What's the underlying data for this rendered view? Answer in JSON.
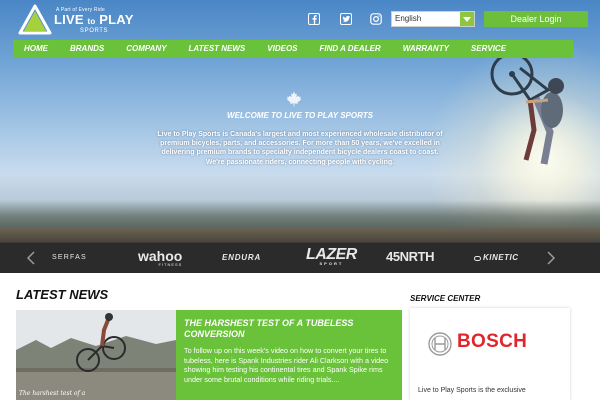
{
  "header": {
    "logo_tagline": "A Part of Every Ride",
    "logo_name_1": "LIVE",
    "logo_name_2": "to",
    "logo_name_3": "PLAY",
    "logo_sub": "SPORTS",
    "social": [
      "facebook-icon",
      "twitter-icon",
      "instagram-icon"
    ],
    "language_selected": "English",
    "dealer_login_label": "Dealer Login"
  },
  "nav": {
    "items": [
      "HOME",
      "BRANDS",
      "COMPANY",
      "LATEST NEWS",
      "VIDEOS",
      "FIND A DEALER",
      "WARRANTY",
      "SERVICE"
    ]
  },
  "hero": {
    "title": "WELCOME TO LIVE TO PLAY SPORTS",
    "body": "Live to Play Sports is Canada's largest and most experienced wholesale distributor of premium bicycles, parts, and accessories. For more than 50 years, we've excelled in delivering premium brands to specialty independent bicycle dealers coast to coast. We're passionate riders, connecting people with cycling."
  },
  "brands": {
    "items": [
      "SERFAS",
      "wahoo",
      "FITNESS",
      "ENDURA",
      "LAZER",
      "SPORT",
      "45NRTH",
      "KINETIC"
    ]
  },
  "news": {
    "heading": "LATEST NEWS",
    "photo_caption": "The harshest test of a",
    "card_title": "THE HARSHEST TEST OF A TUBELESS CONVERSION",
    "card_body": "To follow up on this week's video on how to convert your tires to tubeless, here is Spank Industries rider Ali Clarkson with a video showing him testing his continental tires and Spank Spike rims under some brutal conditions while riding trials...."
  },
  "service": {
    "heading": "SERVICE CENTER",
    "brand": "BOSCH",
    "text": "Live to Play Sports is the exclusive"
  },
  "colors": {
    "accent_green": "#6ac13a",
    "brands_bar": "#2b2b2b",
    "bosch_red": "#e0262d"
  }
}
